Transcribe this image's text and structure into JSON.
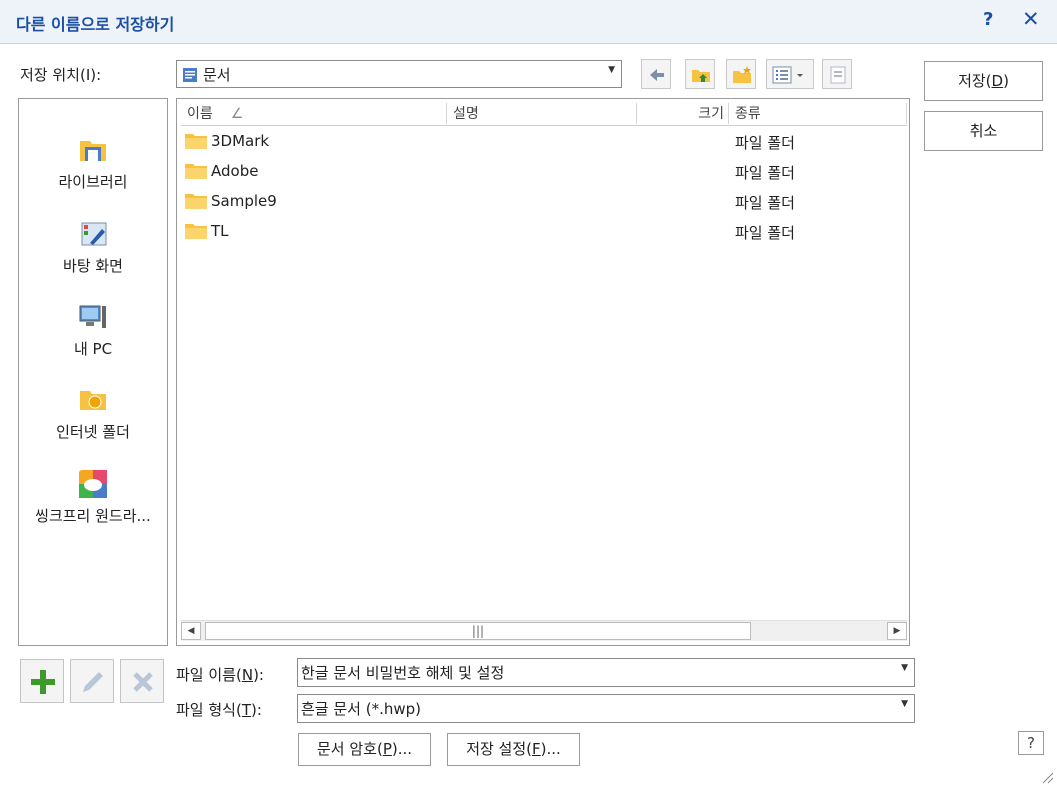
{
  "title": "다른 이름으로 저장하기",
  "titlebar": {
    "help": "?",
    "close": "✕"
  },
  "location": {
    "label": "저장 위치(I):",
    "value": "문서"
  },
  "toolbar": {
    "back": "back-icon",
    "up": "folder-up-icon",
    "new_folder": "new-folder-icon",
    "view": "view-menu-icon",
    "extra": "properties-icon"
  },
  "places": [
    {
      "label": "라이브러리",
      "icon": "library-icon"
    },
    {
      "label": "바탕 화면",
      "icon": "desktop-icon"
    },
    {
      "label": "내 PC",
      "icon": "computer-icon"
    },
    {
      "label": "인터넷 폴더",
      "icon": "internet-folder-icon"
    },
    {
      "label": "씽크프리 원드라...",
      "icon": "thinkfree-icon"
    }
  ],
  "columns": {
    "name": "이름",
    "sort_indicator": "∠",
    "desc": "설명",
    "size": "크기",
    "type": "종류"
  },
  "files": [
    {
      "name": "3DMark",
      "type": "파일 폴더"
    },
    {
      "name": "Adobe",
      "type": "파일 폴더"
    },
    {
      "name": "Sample9",
      "type": "파일 폴더"
    },
    {
      "name": "TL",
      "type": "파일 폴더"
    }
  ],
  "filename": {
    "label_pre": "파일 이름(",
    "label_key": "N",
    "label_post": "):",
    "value": "한글 문서 비밀번호 해체 및 설정"
  },
  "filetype": {
    "label_pre": "파일 형식(",
    "label_key": "T",
    "label_post": "):",
    "value": "흔글 문서 (*.hwp)"
  },
  "buttons": {
    "save_pre": "저장(",
    "save_key": "D",
    "save_post": ")",
    "cancel": "취소",
    "password_pre": "문서 암호(",
    "password_key": "P",
    "password_post": ")...",
    "settings_pre": "저장 설정(",
    "settings_key": "F",
    "settings_post": ")...",
    "help": "?"
  },
  "colors": {
    "accent": "#1a4fa3",
    "folder": "#f5c242",
    "add": "#3c9a2a"
  }
}
